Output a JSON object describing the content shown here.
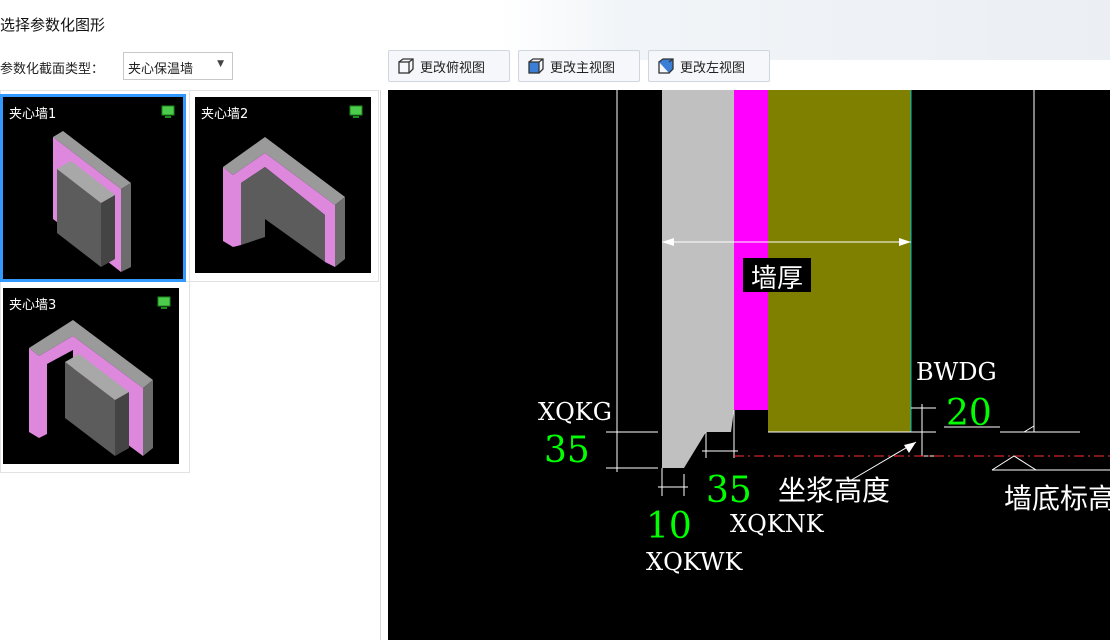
{
  "window": {
    "title": "选择参数化图形"
  },
  "section_type": {
    "label": "参数化截面类型：",
    "selected": "夹心保温墙"
  },
  "toolbar": {
    "top_view": "更改俯视图",
    "front_view": "更改主视图",
    "left_view": "更改左视图"
  },
  "thumbnails": [
    {
      "name": "夹心墙1",
      "selected": true
    },
    {
      "name": "夹心墙2",
      "selected": false
    },
    {
      "name": "夹心墙3",
      "selected": false
    }
  ],
  "drawing": {
    "wall_thickness_label": "墙厚",
    "bwdg_label": "BWDG",
    "bwdg_value": "20",
    "xqkg_label": "XQKG",
    "xqkg_value": "35",
    "xqknk_value": "35",
    "xqknk_label": "XQKNK",
    "mortar_label": "坐浆高度",
    "xqkwk_value": "10",
    "xqkwk_label": "XQKWK",
    "wall_bottom_label": "墙底标高",
    "colors": {
      "insulation": "#ff00ff",
      "outer_leaf": "#808000",
      "inner_leaf": "#c0c0c0",
      "dim_value": "#00ff00"
    }
  }
}
